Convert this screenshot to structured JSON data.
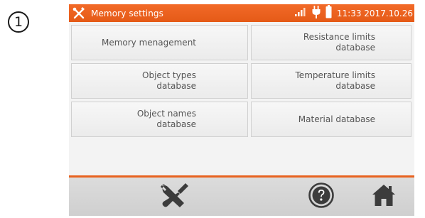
{
  "step_marker": "1",
  "status_bar": {
    "title": "Memory settings",
    "datetime": "11:33 2017.10.26",
    "icons": [
      "tool-icon",
      "signal-icon",
      "plug-icon",
      "battery-icon"
    ],
    "color": "#e9601d"
  },
  "tiles": [
    {
      "label": "Memory menagement",
      "column": "left",
      "row": 1
    },
    {
      "label": "Resistance limits\ndatabase",
      "column": "right",
      "row": 1
    },
    {
      "label": "Object types\ndatabase",
      "column": "left",
      "row": 2
    },
    {
      "label": "Temperature limits\ndatabase",
      "column": "right",
      "row": 2
    },
    {
      "label": "Object names\ndatabase",
      "column": "left",
      "row": 3
    },
    {
      "label": "Material database",
      "column": "right",
      "row": 3
    }
  ],
  "bottom_bar": {
    "buttons": [
      "settings-icon",
      "help-icon",
      "home-icon"
    ]
  }
}
